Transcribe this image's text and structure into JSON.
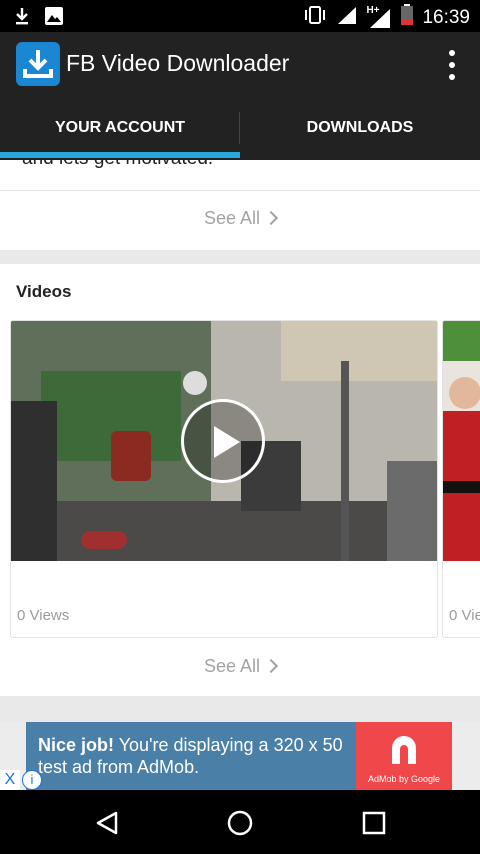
{
  "status_bar": {
    "time": "16:39",
    "network_label": "H+",
    "icons": [
      "download-icon",
      "image-icon",
      "vibrate-icon",
      "signal-icon",
      "battery-icon"
    ]
  },
  "app_bar": {
    "title": "FB Video Downloader",
    "icon": "download-icon",
    "menu_icon": "overflow-menu-icon"
  },
  "tabs": [
    {
      "label": "YOUR ACCOUNT",
      "selected": true
    },
    {
      "label": "DOWNLOADS",
      "selected": false
    }
  ],
  "feed": {
    "cut_off_text": "and lets get motivated.",
    "see_all_label_1": "See All",
    "section_title": "Videos",
    "videos": [
      {
        "views": "0 Views"
      },
      {
        "views": "0 Vie"
      }
    ],
    "see_all_label_2": "See All"
  },
  "ad_banner": {
    "headline": "Nice job!",
    "body": " You're displaying a 320 x 50 test ad from AdMob.",
    "brand": "AdMob by Google",
    "close_label": "X",
    "info_label": "i"
  },
  "nav_bar": {
    "icons": [
      "back-icon",
      "home-icon",
      "recents-icon"
    ]
  },
  "colors": {
    "accent": "#29a9e0",
    "app_bar": "#222222",
    "ad_background": "#4a7fa7",
    "ad_logo": "#f0484a"
  }
}
